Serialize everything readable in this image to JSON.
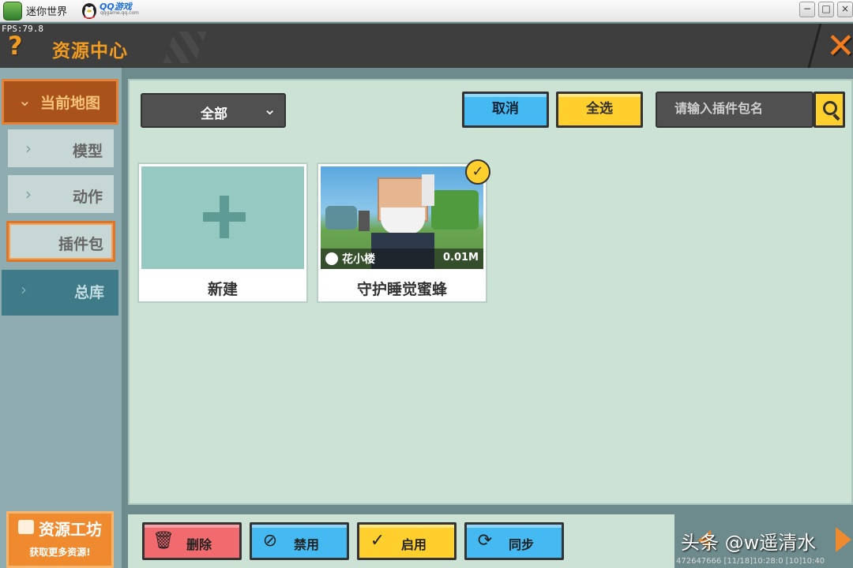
{
  "window": {
    "app_name": "迷你世界",
    "platform_name": "QQ游戏",
    "platform_sub": "qqgame.qq.com",
    "minimize": "−",
    "maximize": "□",
    "close": "×"
  },
  "header": {
    "fps": "FPS:79.8",
    "help": "?",
    "title": "资源中心",
    "close": "✕"
  },
  "sidebar": {
    "current": "当前地图",
    "items": [
      {
        "label": "模型"
      },
      {
        "label": "动作"
      },
      {
        "label": "插件包"
      }
    ],
    "library": "总库",
    "workshop": {
      "title": "资源工坊",
      "subtitle": "获取更多资源!"
    }
  },
  "toolbar": {
    "filter_value": "全部",
    "cancel": "取消",
    "select_all": "全选",
    "search_placeholder": "请输入插件包名"
  },
  "cards": [
    {
      "name": "新建",
      "type": "new"
    },
    {
      "name": "守护睡觉蜜蜂",
      "author": "花小楼",
      "size": "0.01M",
      "selected": true
    }
  ],
  "actions": {
    "delete": "删除",
    "disable": "禁用",
    "enable": "启用",
    "sync": "同步"
  },
  "footer": {
    "info": "472647666   [11/18]10:28:0   [10]10:40",
    "watermark": "头条 @w遥清水"
  },
  "colors": {
    "accent_orange": "#f39b1e",
    "panel_bg": "#cce2d5",
    "yellow": "#ffd02d",
    "blue": "#45b9f1",
    "red": "#f06a6e"
  }
}
